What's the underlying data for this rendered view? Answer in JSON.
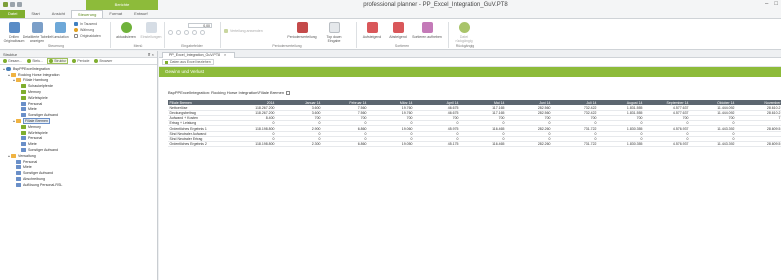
{
  "app": {
    "title": "professional planner - PP_Excel_Integration_GuV.PT8",
    "context_tab": "Berichte",
    "window_controls": [
      "–",
      "□"
    ]
  },
  "ribbon_tabs": [
    {
      "label": "Datei",
      "state": "file"
    },
    {
      "label": "Start",
      "state": ""
    },
    {
      "label": "Ansicht",
      "state": ""
    },
    {
      "label": "Steuerung",
      "state": "active"
    },
    {
      "label": "Format",
      "state": ""
    },
    {
      "label": "Entwurf",
      "state": ""
    }
  ],
  "ribbon": {
    "steuerung": {
      "label": "Steuerung",
      "drillen": "Drillen\nOriginalbaum",
      "detail": "Detaillierte Tabelle\nanzeigen",
      "kumulation": "Kumulation",
      "in_tausend": "In Tausend",
      "waehrung": "Währung",
      "originaldaten": "Originaldaten"
    },
    "menu": {
      "label": "Menü",
      "aktualisieren": "aktualisieren",
      "einstellungen": "Einstellungen"
    },
    "eingabefelder": {
      "label": "Eingabefelder",
      "value": "0,00"
    },
    "periodenverteilung": {
      "label": "Periodenverteilung",
      "verteilung": "Verteilung anwenden",
      "periodenverteilung": "Periodenverteilung",
      "top_down": "Top down\nEingabe"
    },
    "sortieren": {
      "label": "Sortieren",
      "aufsteigend": "Aufsteigend",
      "absteigend": "Absteigend",
      "aufheben": "Sortieren aufheben"
    },
    "rueckgaengig": {
      "label": "Rückgängig",
      "button": "Datei\nrückgängig"
    }
  },
  "left_panel": {
    "title": "Struktur",
    "pin_close": "⊼ × ",
    "tabs": [
      {
        "label": "Gesam...",
        "sel": false
      },
      {
        "label": "Stelu...",
        "sel": false
      },
      {
        "label": "Struktur",
        "sel": true
      },
      {
        "label": "Periode",
        "sel": false
      },
      {
        "label": "Browser",
        "sel": false
      }
    ],
    "tree": [
      {
        "indent": 0,
        "tog": "▲",
        "icon": "db",
        "label": "BspPPExcelIntegration"
      },
      {
        "indent": 1,
        "tog": "▲",
        "icon": "grp",
        "label": "Rocking Horse Integration"
      },
      {
        "indent": 2,
        "tog": "▲",
        "icon": "grp",
        "label": "Filiale Hamburg"
      },
      {
        "indent": 3,
        "tog": "",
        "icon": "gr",
        "label": "Schaukelpferde"
      },
      {
        "indent": 3,
        "tog": "",
        "icon": "gr",
        "label": "Memory"
      },
      {
        "indent": 3,
        "tog": "",
        "icon": "gr",
        "label": "Würfelspiele"
      },
      {
        "indent": 3,
        "tog": "",
        "icon": "bl",
        "label": "Personal"
      },
      {
        "indent": 3,
        "tog": "",
        "icon": "bl",
        "label": "Miete"
      },
      {
        "indent": 3,
        "tog": "",
        "icon": "bl",
        "label": "Sonstiger Aufwand"
      },
      {
        "indent": 2,
        "tog": "▲",
        "icon": "grp",
        "label": "Filiale Bremen",
        "sel": true
      },
      {
        "indent": 3,
        "tog": "",
        "icon": "gr",
        "label": "Memory"
      },
      {
        "indent": 3,
        "tog": "",
        "icon": "gr",
        "label": "Würfelspiele"
      },
      {
        "indent": 3,
        "tog": "",
        "icon": "bl",
        "label": "Personal"
      },
      {
        "indent": 3,
        "tog": "",
        "icon": "bl",
        "label": "Miete"
      },
      {
        "indent": 3,
        "tog": "",
        "icon": "bl",
        "label": "Sonstiger Aufwand"
      },
      {
        "indent": 1,
        "tog": "▲",
        "icon": "grp",
        "label": "Verwaltung"
      },
      {
        "indent": 2,
        "tog": "",
        "icon": "bl",
        "label": "Personal"
      },
      {
        "indent": 2,
        "tog": "",
        "icon": "bl",
        "label": "Miete"
      },
      {
        "indent": 2,
        "tog": "",
        "icon": "bl",
        "label": "Sonstiger Aufwand"
      },
      {
        "indent": 2,
        "tog": "",
        "icon": "bl",
        "label": "Abschreibung"
      },
      {
        "indent": 2,
        "tog": "",
        "icon": "bl",
        "label": "Auflösung Personal-RSL"
      }
    ]
  },
  "document": {
    "tab_label": "PP_Excel_Integration_GuV.PT8",
    "tab_close": "×",
    "toolbar_button": "Daten aus Excel beziehen",
    "band_title": "Gewinn und Verlust",
    "breadcrumb": "BspPPExcelIntegration: Rocking Horse Integration\\Filiale Bremen",
    "headers": [
      "Filiale Bremen",
      "2014",
      "Januar 14",
      "Februar 14",
      "März 14",
      "April 14",
      "Mai 14",
      "Juni 14",
      "Juli 14",
      "August 14",
      "September 14",
      "Oktober 14",
      "November"
    ],
    "rows": [
      {
        "bold": false,
        "cells": [
          "Nettoerlöse",
          "118.267.200",
          "3.600",
          "7.560",
          "19.760",
          "46.675",
          "117.165",
          "282.560",
          "732.422",
          "1.831.555",
          "4.577.637",
          "11.444.092",
          "28.610.2"
        ]
      },
      {
        "bold": false,
        "cells": [
          "Deckungsbeitrag",
          "118.267.200",
          "3.600",
          "7.560",
          "19.760",
          "46.675",
          "117.165",
          "282.560",
          "732.422",
          "1.831.555",
          "4.577.637",
          "11.444.092",
          "28.610.2"
        ]
      },
      {
        "bold": false,
        "cells": [
          "Aufwand + Kosten",
          "8.400",
          "700",
          "700",
          "700",
          "700",
          "700",
          "700",
          "700",
          "700",
          "700",
          "700",
          "7"
        ]
      },
      {
        "bold": false,
        "cells": [
          "Ertrag + Leistung",
          "0",
          "0",
          "0",
          "0",
          "0",
          "0",
          "0",
          "0",
          "0",
          "0",
          "0",
          ""
        ]
      },
      {
        "bold": true,
        "cells": [
          "Ordentliches Ergebnis 1",
          "118.198.800",
          "2.900",
          "6.860",
          "19.060",
          "45.975",
          "116.465",
          "282.260",
          "731.722",
          "1.830.355",
          "4.576.937",
          "11.443.392",
          "28.609.5"
        ]
      },
      {
        "bold": false,
        "cells": [
          "Sind Neutraler Aufwand",
          "0",
          "0",
          "0",
          "0",
          "0",
          "0",
          "0",
          "0",
          "0",
          "0",
          "0",
          ""
        ]
      },
      {
        "bold": false,
        "cells": [
          "Sind Neutraler Ertrag",
          "0",
          "0",
          "0",
          "0",
          "0",
          "0",
          "0",
          "0",
          "0",
          "0",
          "0",
          ""
        ]
      },
      {
        "bold": true,
        "cells": [
          "Ordentliches Ergebnis 2",
          "118.198.800",
          "2.300",
          "6.860",
          "19.050",
          "45.175",
          "116.465",
          "282.260",
          "731.722",
          "1.830.355",
          "4.576.937",
          "11.443.392",
          "28.609.5"
        ]
      }
    ]
  },
  "colors": {
    "accent_green": "#8dbb3a",
    "file_tab": "#7fae2e",
    "header_dark": "#5c6670"
  }
}
